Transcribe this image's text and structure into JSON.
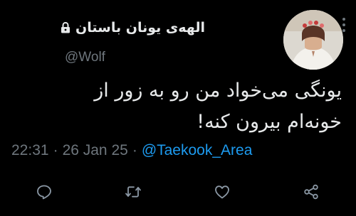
{
  "tweet": {
    "display_name": "الهه‌ی یونان باستان",
    "handle": "@Wolf",
    "text_line1": "یونگی می‌خواد من رو به زور از",
    "text_line2": "خونه‌ام بیرون کنه!",
    "time": "22:31",
    "date": "26 Jan 25",
    "separator": "·",
    "source": "@Taekook_Area"
  },
  "icons": {
    "lock": "lock-icon",
    "more": "vertical-ellipsis-icon",
    "reply": "reply-icon",
    "retweet": "retweet-icon",
    "like": "heart-icon",
    "share": "share-icon"
  },
  "colors": {
    "background": "#000000",
    "text": "#e7e9ea",
    "muted": "#6e767d",
    "link": "#1d9bf0"
  }
}
